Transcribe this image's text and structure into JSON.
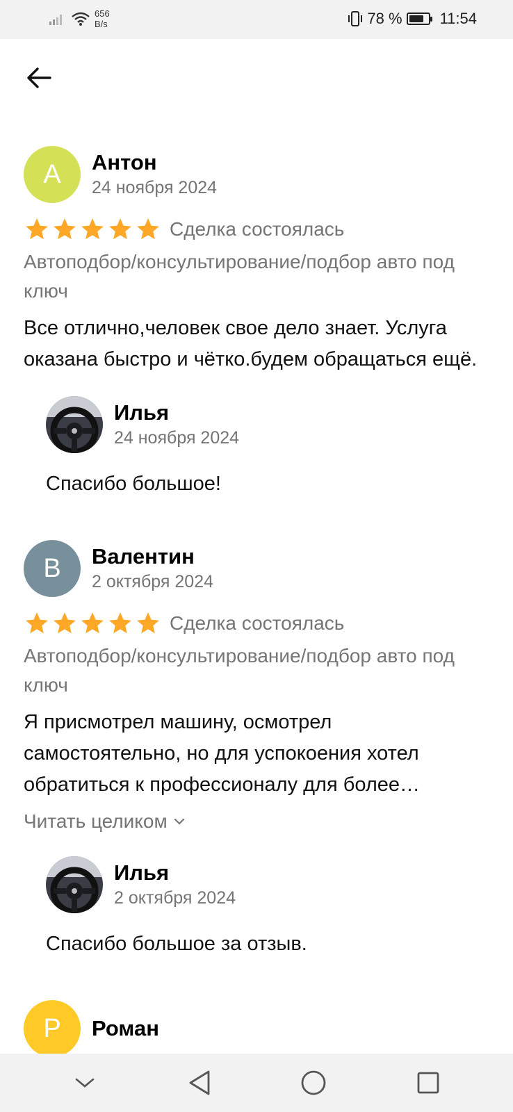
{
  "status": {
    "netspeed_value": "656",
    "netspeed_unit": "B/s",
    "battery": "78 %",
    "battery_level": 0.78,
    "time": "11:54"
  },
  "reviews": [
    {
      "initial": "А",
      "avatar_color": "#d4e157",
      "name": "Антон",
      "date": "24 ноября 2024",
      "stars": 5,
      "deal": "Сделка состоялась",
      "service": "Автоподбор/консультирование/подбор авто под ключ",
      "text": "Все отлично,человек свое дело знает. Услуга оказана быстро и чётко.будем обращаться ещё.",
      "reply": {
        "name": "Илья",
        "date": "24 ноября 2024",
        "text": "Спасибо большое!"
      }
    },
    {
      "initial": "В",
      "avatar_color": "#78909c",
      "name": "Валентин",
      "date": "2 октября 2024",
      "stars": 5,
      "deal": "Сделка состоялась",
      "service": "Автоподбор/консультирование/подбор авто под ключ",
      "text": "Я присмотрел машину, осмотрел самостоятельно, но для успокоения хотел обратиться к профессионалу для более надёжной проверки.",
      "read_more": "Читать целиком",
      "reply": {
        "name": "Илья",
        "date": "2 октября 2024",
        "text": "Спасибо большое за отзыв."
      }
    },
    {
      "initial": "Р",
      "avatar_color": "#ffca28",
      "name": "Роман"
    }
  ],
  "colors": {
    "star": "#ffa726",
    "muted": "#757575"
  }
}
